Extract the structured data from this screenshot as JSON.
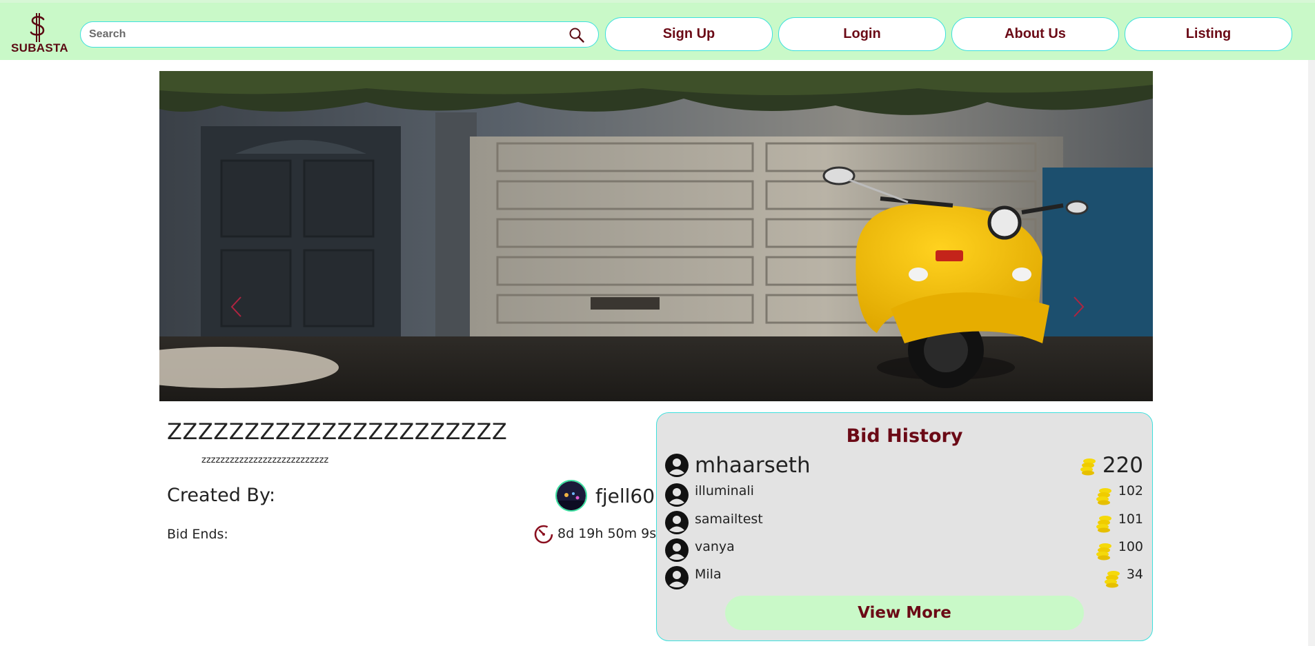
{
  "brand": {
    "logo_text": "SUBASTA",
    "accent_color": "#6b0a16",
    "nav_bg": "#c9f9c8",
    "border_color": "#3ce0dd"
  },
  "search": {
    "placeholder": "Search",
    "icon": "search-icon"
  },
  "nav": {
    "signup": "Sign Up",
    "login": "Login",
    "about": "About Us",
    "listing": "Listing"
  },
  "carousel": {
    "prev_icon": "chevron-left-icon",
    "next_icon": "chevron-right-icon"
  },
  "item": {
    "title": "ZZZZZZZZZZZZZZZZZZZZZZ",
    "description": "zzzzzzzzzzzzzzzzzzzzzzzzzzz",
    "created_by_label": "Created By:",
    "creator_name": "fjell60",
    "bid_ends_label": "Bid Ends:",
    "countdown": "8d 19h 50m 9s"
  },
  "bid_history": {
    "title": "Bid History",
    "bids": [
      {
        "user": "mhaarseth",
        "amount": "220"
      },
      {
        "user": "illuminali",
        "amount": "102"
      },
      {
        "user": "samailtest",
        "amount": "101"
      },
      {
        "user": "vanya",
        "amount": "100"
      },
      {
        "user": "Mila",
        "amount": "34"
      }
    ],
    "view_more": "View More"
  }
}
